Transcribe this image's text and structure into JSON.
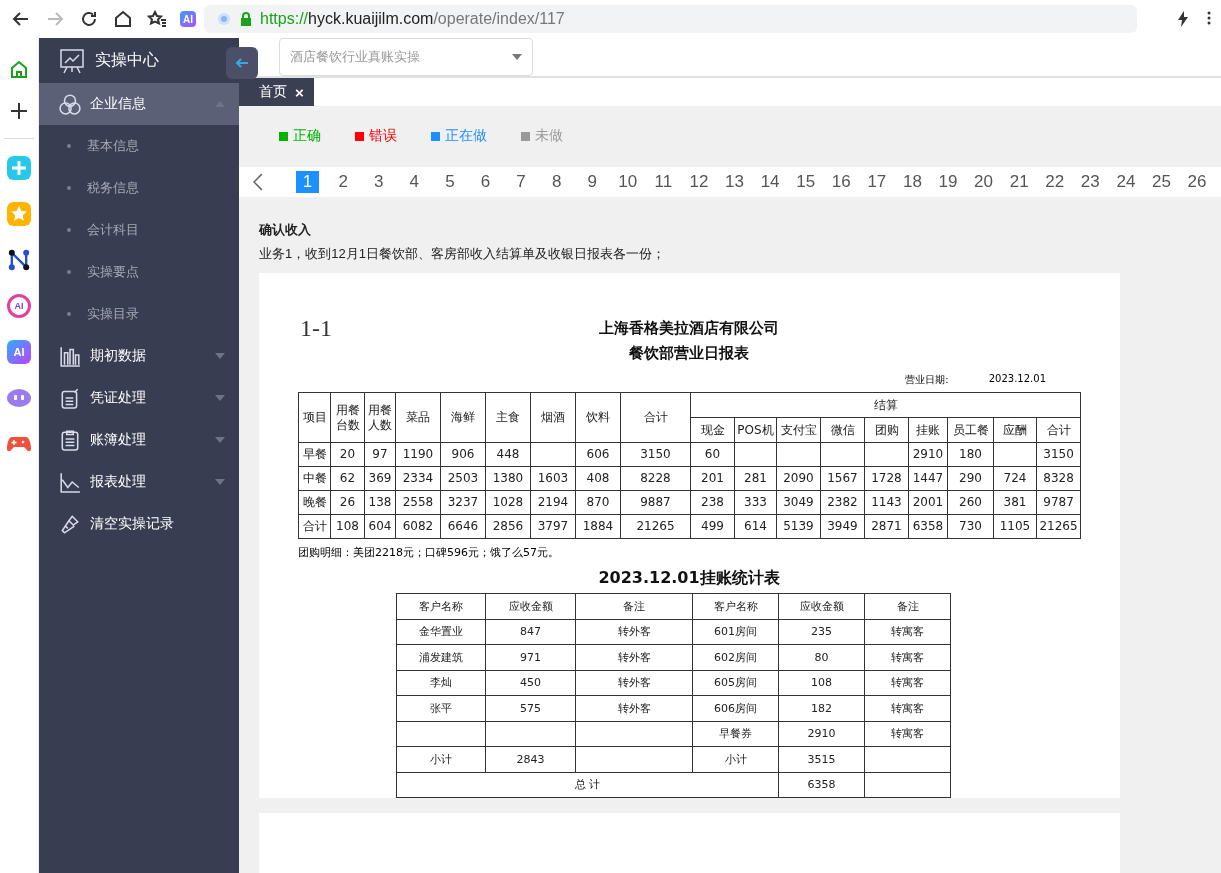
{
  "browser": {
    "url_scheme": "https://",
    "url_host": "hyck.kuaijilm.com",
    "url_path": "/operate/index/117",
    "toolbar_badge": "AI",
    "forward_disabled": true
  },
  "browser_sidebar": [
    {
      "kind": "home"
    },
    {
      "kind": "plus"
    },
    {
      "kind": "cross"
    },
    {
      "kind": "star"
    },
    {
      "kind": "network"
    },
    {
      "kind": "ai-ring",
      "label": "AI"
    },
    {
      "kind": "ai",
      "label": "AI"
    },
    {
      "kind": "bot"
    },
    {
      "kind": "gamepad"
    }
  ],
  "sidebar": {
    "title": "实操中心",
    "items": [
      {
        "label": "企业信息",
        "kind": "group",
        "expanded": true,
        "selected": true,
        "children": [
          {
            "label": "基本信息"
          },
          {
            "label": "税务信息"
          },
          {
            "label": "会计科目"
          },
          {
            "label": "实操要点"
          },
          {
            "label": "实操目录"
          }
        ]
      },
      {
        "label": "期初数据",
        "kind": "group",
        "expanded": false,
        "selected": false
      },
      {
        "label": "凭证处理",
        "kind": "group",
        "expanded": false,
        "selected": false
      },
      {
        "label": "账簿处理",
        "kind": "group",
        "expanded": false,
        "selected": false
      },
      {
        "label": "报表处理",
        "kind": "group",
        "expanded": false,
        "selected": false
      },
      {
        "label": "清空实操记录",
        "kind": "action",
        "selected": false
      }
    ]
  },
  "topbar": {
    "select_value": "酒店餐饮行业真账实操"
  },
  "tabs": [
    {
      "label": "首页",
      "selected": true,
      "close": "×"
    }
  ],
  "legend": [
    {
      "label": "正确",
      "color": "#00b400"
    },
    {
      "label": "错误",
      "color": "#ff0000"
    },
    {
      "label": "正在做",
      "color": "#1e8fff"
    },
    {
      "label": "未做",
      "color": "#999999"
    }
  ],
  "pages": [
    {
      "label": "1",
      "selected": true
    },
    {
      "label": "2",
      "selected": false
    },
    {
      "label": "3",
      "selected": false
    },
    {
      "label": "4",
      "selected": false
    },
    {
      "label": "5",
      "selected": false
    },
    {
      "label": "6",
      "selected": false
    },
    {
      "label": "7",
      "selected": false
    },
    {
      "label": "8",
      "selected": false
    },
    {
      "label": "9",
      "selected": false
    },
    {
      "label": "10",
      "selected": false
    },
    {
      "label": "11",
      "selected": false
    },
    {
      "label": "12",
      "selected": false
    },
    {
      "label": "13",
      "selected": false
    },
    {
      "label": "14",
      "selected": false
    },
    {
      "label": "15",
      "selected": false
    },
    {
      "label": "16",
      "selected": false
    },
    {
      "label": "17",
      "selected": false
    },
    {
      "label": "18",
      "selected": false
    },
    {
      "label": "19",
      "selected": false
    },
    {
      "label": "20",
      "selected": false
    },
    {
      "label": "21",
      "selected": false
    },
    {
      "label": "22",
      "selected": false
    },
    {
      "label": "23",
      "selected": false
    },
    {
      "label": "24",
      "selected": false
    },
    {
      "label": "25",
      "selected": false
    },
    {
      "label": "26",
      "selected": false
    }
  ],
  "task": {
    "title": "确认收入",
    "description": "业务1，收到12月1日餐饮部、客房部收入结算单及收银日报表各一份；"
  },
  "document": {
    "number": "1-1",
    "company": "上海香格美拉酒店有限公司",
    "title": "餐饮部营业日报表",
    "date_label": "营业日期:",
    "date": "2023.12.01",
    "report": {
      "columns": [
        "项目",
        "用餐台数",
        "用餐人数",
        "菜品",
        "海鲜",
        "主食",
        "烟酒",
        "饮料",
        "合计"
      ],
      "settlement_label": "结算",
      "settlement_columns": [
        "现金",
        "POS机",
        "支付宝",
        "微信",
        "团购",
        "挂账",
        "员工餐",
        "应酬",
        "合计"
      ],
      "rows": [
        [
          "早餐",
          "20",
          "97",
          "1190",
          "906",
          "448",
          null,
          "606",
          "3150",
          "60",
          null,
          null,
          null,
          null,
          "2910",
          "180",
          null,
          "3150"
        ],
        [
          "中餐",
          "62",
          "369",
          "2334",
          "2503",
          "1380",
          "1603",
          "408",
          "8228",
          "201",
          "281",
          "2090",
          "1567",
          "1728",
          "1447",
          "290",
          "724",
          "8328"
        ],
        [
          "晚餐",
          "26",
          "138",
          "2558",
          "3237",
          "1028",
          "2194",
          "870",
          "9887",
          "238",
          "333",
          "3049",
          "2382",
          "1143",
          "2001",
          "260",
          "381",
          "9787"
        ],
        [
          "合计",
          "108",
          "604",
          "6082",
          "6646",
          "2856",
          "3797",
          "1884",
          "21265",
          "499",
          "614",
          "5139",
          "3949",
          "2871",
          "6358",
          "730",
          "1105",
          "21265"
        ]
      ],
      "note": "团购明细：美团2218元；口碑596元；饿了么57元。"
    },
    "ledger": {
      "title": "2023.12.01挂账统计表",
      "columns": [
        "客户名称",
        "应收金额",
        "备注",
        "客户名称",
        "应收金额",
        "备注"
      ],
      "rows": [
        [
          "金华置业",
          "847",
          "转外客",
          "601房间",
          "235",
          "转寓客"
        ],
        [
          "浦发建筑",
          "971",
          "转外客",
          "602房间",
          "80",
          "转寓客"
        ],
        [
          "李灿",
          "450",
          "转外客",
          "605房间",
          "108",
          "转寓客"
        ],
        [
          "张平",
          "575",
          "转外客",
          "606房间",
          "182",
          "转寓客"
        ],
        [
          null,
          null,
          null,
          "早餐券",
          "2910",
          "转寓客"
        ],
        [
          "小计",
          "2843",
          null,
          "小计",
          "3515",
          null
        ]
      ],
      "total_label": "总 计",
      "total_value": "6358"
    }
  }
}
